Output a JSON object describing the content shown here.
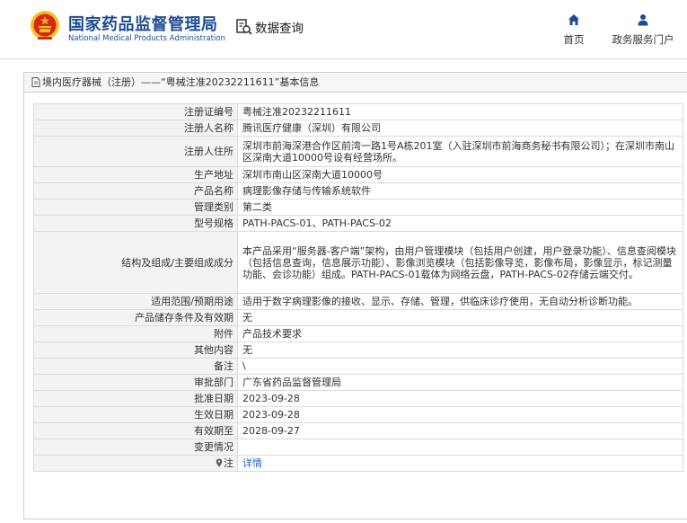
{
  "header": {
    "brand_cn": "国家药品监督管理局",
    "brand_en": "National Medical Products Administration",
    "search_label": "数据查询",
    "nav_home": "首页",
    "nav_service": "政务服务门户"
  },
  "panel": {
    "title": "境内医疗器械（注册）——“粤械注准20232211611”基本信息"
  },
  "rows": [
    {
      "label": "注册证编号",
      "value": "粤械注准20232211611"
    },
    {
      "label": "注册人名称",
      "value": "腾讯医疗健康（深圳）有限公司"
    },
    {
      "label": "注册人住所",
      "value": "深圳市前海深港合作区前湾一路1号A栋201室（入驻深圳市前海商务秘书有限公司）；在深圳市南山区深南大道10000号设有经营场所。"
    },
    {
      "label": "生产地址",
      "value": "深圳市南山区深南大道10000号"
    },
    {
      "label": "产品名称",
      "value": "病理影像存储与传输系统软件"
    },
    {
      "label": "管理类别",
      "value": "第二类"
    },
    {
      "label": "型号规格",
      "value": "PATH-PACS-01、PATH-PACS-02"
    },
    {
      "label": "结构及组成/主要组成成分",
      "value": "本产品采用“服务器-客户端”架构，由用户管理模块（包括用户创建，用户登录功能）、信息查阅模块（包括信息查询，信息展示功能）、影像浏览模块（包括影像导览，影像布局，影像显示，标记测量功能、会诊功能）组成。PATH-PACS-01载体为网络云盘，PATH-PACS-02存储云端交付。"
    },
    {
      "label": "适用范围/预期用途",
      "value": "适用于数字病理影像的接收、显示、存储、管理，供临床诊疗使用，无自动分析诊断功能。"
    },
    {
      "label": "产品储存条件及有效期",
      "value": "无"
    },
    {
      "label": "附件",
      "value": "产品技术要求"
    },
    {
      "label": "其他内容",
      "value": "无"
    },
    {
      "label": "备注",
      "value": "\\"
    },
    {
      "label": "审批部门",
      "value": "广东省药品监督管理局"
    },
    {
      "label": "批准日期",
      "value": "2023-09-28"
    },
    {
      "label": "生效日期",
      "value": "2023-09-28"
    },
    {
      "label": "有效期至",
      "value": "2028-09-27"
    },
    {
      "label": "变更情况",
      "value": ""
    }
  ],
  "note_row": {
    "label": "注",
    "link_text": "详情"
  },
  "colors": {
    "brand_blue": "#1e4c94",
    "link_blue": "#1e66c8",
    "emblem_red": "#d8261c",
    "emblem_gold": "#f2c21b"
  }
}
